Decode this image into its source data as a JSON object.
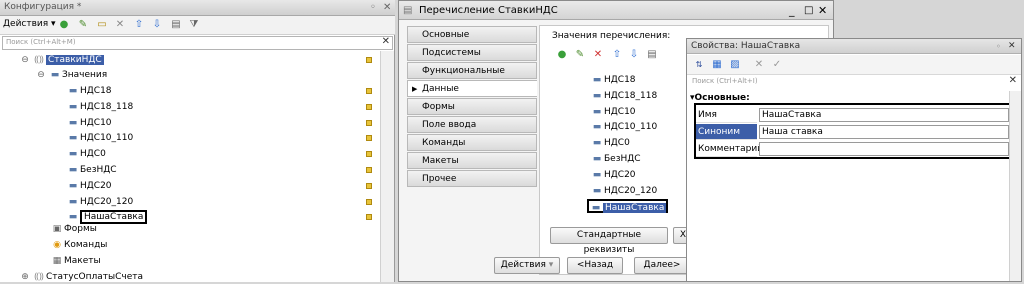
{
  "config_panel": {
    "title": "Конфигурация *",
    "actions_label": "Действия",
    "search_placeholder": "Поиск (Ctrl+Alt+M)",
    "tree": {
      "root": "СтавкиНДС",
      "values_group": "Значения",
      "values": [
        "НДС18",
        "НДС18_118",
        "НДС10",
        "НДС10_110",
        "НДС0",
        "БезНДС",
        "НДС20",
        "НДС20_120",
        "НашаСтавка"
      ],
      "forms": "Формы",
      "commands": "Команды",
      "layouts": "Макеты",
      "next_object": "СтатусОплатыСчета"
    }
  },
  "enum_dialog": {
    "title": "Перечисление СтавкиНДС",
    "tabs": [
      "Основные",
      "Подсистемы",
      "Функциональные опции",
      "Данные",
      "Формы",
      "Поле ввода",
      "Команды",
      "Макеты",
      "Прочее"
    ],
    "active_tab": "Данные",
    "values_label": "Значения перечисления:",
    "values": [
      "НДС18",
      "НДС18_118",
      "НДС10",
      "НДС10_110",
      "НДС0",
      "БезНДС",
      "НДС20",
      "НДС20_120",
      "НашаСтавка"
    ],
    "standard_attrs_button": "Стандартные реквизиты",
    "cut_button": "Х",
    "actions_button": "Действия",
    "back_button": "<Назад",
    "next_button": "Далее>"
  },
  "properties_panel": {
    "title": "Свойства: НашаСтавка",
    "search_placeholder": "Поиск (Ctrl+Alt+I)",
    "section": "Основные:",
    "fields": [
      {
        "label": "Имя",
        "value": "НашаСтавка"
      },
      {
        "label": "Синоним",
        "value": "Наша ставка"
      },
      {
        "label": "Комментарий",
        "value": ""
      }
    ]
  },
  "colors": {
    "selection": "#3c5ea8",
    "add_green": "#3aa03a",
    "delete_red": "#d03030",
    "move_blue": "#2a6ad0"
  }
}
